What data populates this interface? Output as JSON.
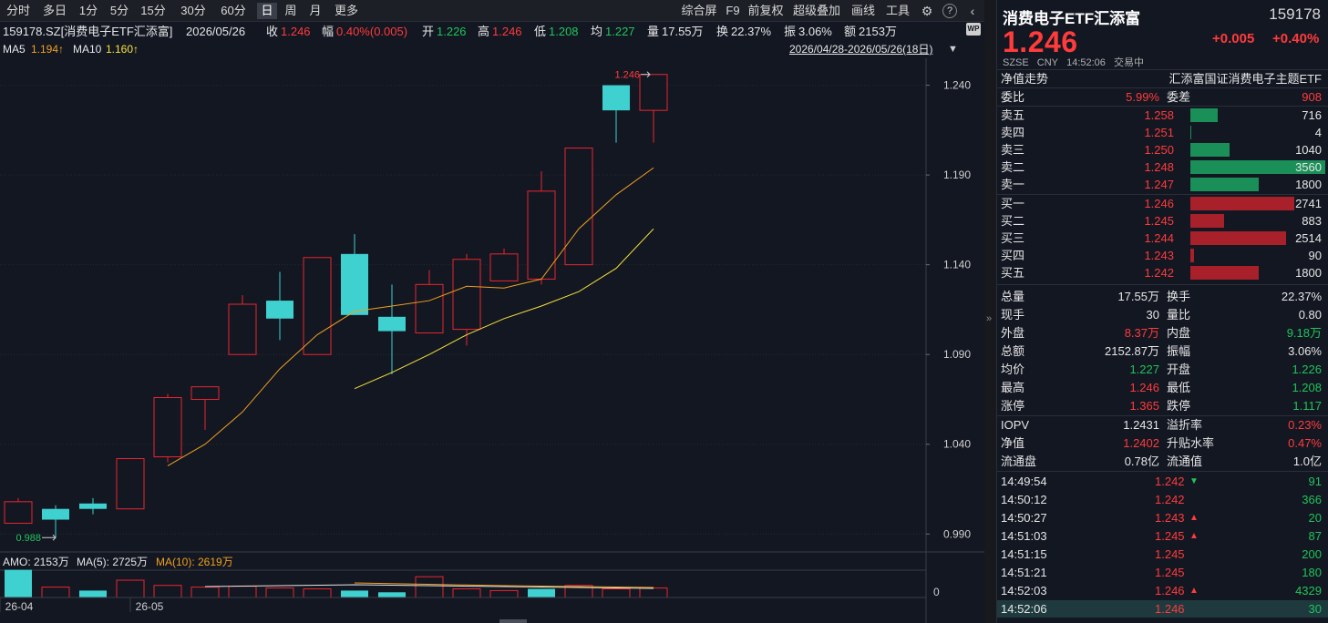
{
  "toolbar": {
    "left": [
      "分时",
      "多日",
      "1分",
      "5分",
      "15分",
      "30分",
      "60分",
      "日",
      "周",
      "月",
      "更多"
    ],
    "active": "日",
    "right": [
      "综合屏",
      "F9",
      "前复权",
      "超级叠加",
      "画线",
      "工具"
    ]
  },
  "quote": {
    "symbol": "159178.SZ[消费电子ETF汇添富]",
    "date": "2026/05/26",
    "close_label": "收",
    "close": "1.246",
    "chg_label": "幅",
    "chg": "0.40%(0.005)",
    "open_label": "开",
    "open": "1.226",
    "high_label": "高",
    "high": "1.246",
    "low_label": "低",
    "low": "1.208",
    "avg_label": "均",
    "avg": "1.227",
    "vol_label": "量",
    "vol": "17.55万",
    "turn_label": "换",
    "turn": "22.37%",
    "amp_label": "振",
    "amp": "3.06%",
    "amt_label": "额",
    "amt": "2153万"
  },
  "ma": {
    "ma5_label": "MA5",
    "ma5": "1.194↑",
    "ma10_label": "MA10",
    "ma10": "1.160↑",
    "range": "2026/04/28-2026/05/26(18日)",
    "wp_badge": "WP"
  },
  "chart_data": {
    "type": "candlestick",
    "y_ticks": [
      "1.240",
      "1.190",
      "1.140",
      "1.090",
      "1.040",
      "0.990"
    ],
    "ylim": [
      0.98,
      1.255
    ],
    "x_labels": [
      "26-04",
      "26-05"
    ],
    "high_marker": "1.246",
    "low_marker": "0.988",
    "candles": [
      {
        "o": 0.996,
        "c": 1.008,
        "h": 1.01,
        "l": 0.996
      },
      {
        "o": 1.004,
        "c": 0.998,
        "h": 1.006,
        "l": 0.988
      },
      {
        "o": 1.007,
        "c": 1.004,
        "h": 1.01,
        "l": 1.001
      },
      {
        "o": 1.004,
        "c": 1.032,
        "h": 1.032,
        "l": 1.004
      },
      {
        "o": 1.033,
        "c": 1.066,
        "h": 1.068,
        "l": 1.03
      },
      {
        "o": 1.065,
        "c": 1.072,
        "h": 1.072,
        "l": 1.048
      },
      {
        "o": 1.09,
        "c": 1.118,
        "h": 1.123,
        "l": 1.09
      },
      {
        "o": 1.12,
        "c": 1.11,
        "h": 1.136,
        "l": 1.098
      },
      {
        "o": 1.09,
        "c": 1.144,
        "h": 1.144,
        "l": 1.09
      },
      {
        "o": 1.146,
        "c": 1.112,
        "h": 1.157,
        "l": 1.112
      },
      {
        "o": 1.111,
        "c": 1.103,
        "h": 1.129,
        "l": 1.079
      },
      {
        "o": 1.102,
        "c": 1.129,
        "h": 1.137,
        "l": 1.102
      },
      {
        "o": 1.104,
        "c": 1.143,
        "h": 1.146,
        "l": 1.095
      },
      {
        "o": 1.131,
        "c": 1.146,
        "h": 1.149,
        "l": 1.131
      },
      {
        "o": 1.132,
        "c": 1.181,
        "h": 1.192,
        "l": 1.129
      },
      {
        "o": 1.14,
        "c": 1.205,
        "h": 1.205,
        "l": 1.14
      },
      {
        "o": 1.24,
        "c": 1.226,
        "h": 1.24,
        "l": 1.208
      },
      {
        "o": 1.226,
        "c": 1.246,
        "h": 1.246,
        "l": 1.208
      }
    ],
    "ma5": [
      null,
      null,
      null,
      null,
      1.028,
      1.04,
      1.058,
      1.082,
      1.101,
      1.114,
      1.117,
      1.12,
      1.128,
      1.127,
      1.132,
      1.16,
      1.179,
      1.194
    ],
    "ma10": [
      null,
      null,
      null,
      null,
      null,
      null,
      null,
      null,
      null,
      1.071,
      1.08,
      1.09,
      1.101,
      1.11,
      1.117,
      1.125,
      1.138,
      1.16
    ],
    "amo": {
      "label": "AMO: 2153万",
      "ma5_label": "MA(5): 2725万",
      "ma10_label": "MA(10): 2619万",
      "zero": "0",
      "up": [
        false,
        true,
        false,
        true,
        true,
        true,
        true,
        true,
        true,
        false,
        false,
        true,
        true,
        true,
        false,
        true,
        true,
        true
      ],
      "values": [
        32,
        12,
        8,
        20,
        14,
        12,
        13,
        11,
        10,
        8,
        6,
        24,
        10,
        8,
        10,
        14,
        10,
        11
      ]
    }
  },
  "right_panel": {
    "name": "消费电子ETF汇添富",
    "code": "159178",
    "price": "1.246",
    "chg": "+0.005",
    "chg_pct": "+0.40%",
    "exchange": "SZSE",
    "currency": "CNY",
    "time": "14:52:06",
    "status": "交易中",
    "nav_label": "净值走势",
    "fund_name": "汇添富国证消费电子主题ETF",
    "weibi_label": "委比",
    "weibi": "5.99%",
    "weicha_label": "委差",
    "weicha": "908",
    "asks": [
      {
        "label": "卖五",
        "price": "1.258",
        "vol": "716",
        "ratio": 0.2
      },
      {
        "label": "卖四",
        "price": "1.251",
        "vol": "4",
        "ratio": 0.01
      },
      {
        "label": "卖三",
        "price": "1.250",
        "vol": "1040",
        "ratio": 0.29
      },
      {
        "label": "卖二",
        "price": "1.248",
        "vol": "3560",
        "ratio": 1.0
      },
      {
        "label": "卖一",
        "price": "1.247",
        "vol": "1800",
        "ratio": 0.51
      }
    ],
    "bids": [
      {
        "label": "买一",
        "price": "1.246",
        "vol": "2741",
        "ratio": 0.77
      },
      {
        "label": "买二",
        "price": "1.245",
        "vol": "883",
        "ratio": 0.25
      },
      {
        "label": "买三",
        "price": "1.244",
        "vol": "2514",
        "ratio": 0.71
      },
      {
        "label": "买四",
        "price": "1.243",
        "vol": "90",
        "ratio": 0.03
      },
      {
        "label": "买五",
        "price": "1.242",
        "vol": "1800",
        "ratio": 0.51
      }
    ],
    "stats": [
      {
        "l1": "总量",
        "v1": "17.55万",
        "c1": "white",
        "l2": "换手",
        "v2": "22.37%",
        "c2": "white"
      },
      {
        "l1": "现手",
        "v1": "30",
        "c1": "white",
        "l2": "量比",
        "v2": "0.80",
        "c2": "white"
      },
      {
        "l1": "外盘",
        "v1": "8.37万",
        "c1": "red",
        "l2": "内盘",
        "v2": "9.18万",
        "c2": "green"
      },
      {
        "l1": "总额",
        "v1": "2152.87万",
        "c1": "white",
        "l2": "振幅",
        "v2": "3.06%",
        "c2": "white"
      },
      {
        "l1": "均价",
        "v1": "1.227",
        "c1": "green",
        "l2": "开盘",
        "v2": "1.226",
        "c2": "green"
      },
      {
        "l1": "最高",
        "v1": "1.246",
        "c1": "red",
        "l2": "最低",
        "v2": "1.208",
        "c2": "green"
      },
      {
        "l1": "涨停",
        "v1": "1.365",
        "c1": "red",
        "l2": "跌停",
        "v2": "1.117",
        "c2": "green"
      }
    ],
    "stats2": [
      {
        "l1": "IOPV",
        "v1": "1.2431",
        "c1": "white",
        "l2": "溢折率",
        "v2": "0.23%",
        "c2": "red"
      },
      {
        "l1": "净值",
        "v1": "1.2402",
        "c1": "red",
        "l2": "升贴水率",
        "v2": "0.47%",
        "c2": "red"
      },
      {
        "l1": "流通盘",
        "v1": "0.78亿",
        "c1": "white",
        "l2": "流通值",
        "v2": "1.0亿",
        "c2": "white"
      }
    ],
    "ticks": [
      {
        "time": "14:49:54",
        "price": "1.242",
        "dir": "down",
        "vol": "91"
      },
      {
        "time": "14:50:12",
        "price": "1.242",
        "dir": "",
        "vol": "366"
      },
      {
        "time": "14:50:27",
        "price": "1.243",
        "dir": "up",
        "vol": "20"
      },
      {
        "time": "14:51:03",
        "price": "1.245",
        "dir": "up",
        "vol": "87"
      },
      {
        "time": "14:51:15",
        "price": "1.245",
        "dir": "",
        "vol": "200"
      },
      {
        "time": "14:51:21",
        "price": "1.245",
        "dir": "",
        "vol": "180"
      },
      {
        "time": "14:52:03",
        "price": "1.246",
        "dir": "up",
        "vol": "4329"
      },
      {
        "time": "14:52:06",
        "price": "1.246",
        "dir": "",
        "vol": "30"
      }
    ]
  },
  "colors": {
    "up": "#ff3b3b",
    "down": "#1fc45a",
    "candle_down_fill": "#3fd0d0",
    "ma5": "#f0a020",
    "ma10": "#f6e23a"
  }
}
